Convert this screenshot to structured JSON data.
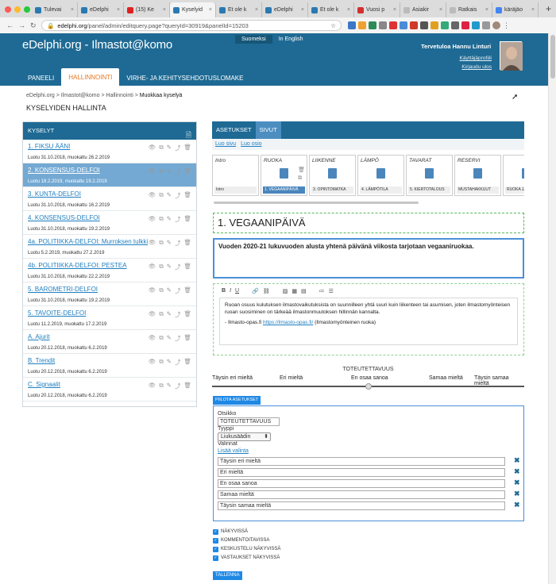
{
  "browser": {
    "tabs": [
      {
        "label": "Tulevai",
        "color": "#2a7ab0"
      },
      {
        "label": "eDelphi",
        "color": "#2a7ab0"
      },
      {
        "label": "(15) Ke",
        "color": "#e02020"
      },
      {
        "label": "Kyselyid",
        "color": "#2a7ab0",
        "active": true
      },
      {
        "label": "Et ole k",
        "color": "#2a7ab0"
      },
      {
        "label": "eDelphi",
        "color": "#2a7ab0"
      },
      {
        "label": "Et ole k",
        "color": "#2a7ab0"
      },
      {
        "label": "Vuosi p",
        "color": "#d32f2f"
      },
      {
        "label": "Asiakir",
        "color": "#bbb"
      },
      {
        "label": "Ratkais",
        "color": "#bbb"
      },
      {
        "label": "käräjäo",
        "color": "#4285f4"
      }
    ],
    "url_host": "edelphi.org",
    "url_path": "/panel/admin/editquery.page?queryId=30919&panelId=15203"
  },
  "header": {
    "logo": "eDelphi.org - Ilmastot@komo",
    "lang_fi": "Suomeksi",
    "lang_en": "In English",
    "welcome": "Tervetuloa  Hannu Linturi",
    "profile_link": "Käyttäjäprofiili",
    "logout_link": "Kirjaudu ulos",
    "nav": [
      "PANEELI",
      "HALLINNOINTI",
      "VIRHE- JA KEHITYSEHDOTUSLOMAKE"
    ]
  },
  "breadcrumb": {
    "items": [
      "eDelphi.org",
      "Ilmastot@komo",
      "Hallinnointi"
    ],
    "current": "Muokkaa kyselyä"
  },
  "page_title": "KYSELYIDEN HALLINTA",
  "left_panel": {
    "title": "KYSELYT",
    "queries": [
      {
        "title": "1. FIKSU ÄÄNI",
        "meta": "Luotu 31.10.2018, muokattu 26.2.2019"
      },
      {
        "title": "2. KONSENSUS-DELFOI",
        "meta": "Luotu 18.2.2019, muokattu 19.2.2019",
        "selected": true
      },
      {
        "title": "3. KUNTA-DELFOI",
        "meta": "Luotu 31.10.2018, muokattu 16.2.2019"
      },
      {
        "title": "4. KONSENSUS-DELFOI",
        "meta": "Luotu 31.10.2018, muokattu 19.2.2019"
      },
      {
        "title": "4a. POLITIIKKA-DELFOI: Murroksen tulkki",
        "meta": "Luotu 5.2.2019, muokattu 27.2.2019"
      },
      {
        "title": "4b. POLITIIKKA-DELFOI: PESTEA",
        "meta": "Luotu 31.10.2018, muokattu 22.2.2019"
      },
      {
        "title": "5. BAROMETRI-DELFOI",
        "meta": "Luotu 31.10.2018, muokattu 19.2.2019"
      },
      {
        "title": "5. TAVOITE-DELFOI",
        "meta": "Luotu 11.2.2019, muokattu 17.2.2019"
      },
      {
        "title": "A. Ajurit",
        "meta": "Luotu 20.12.2018, muokattu 6.2.2019"
      },
      {
        "title": "B. Trendit",
        "meta": "Luotu 20.12.2018, muokattu 6.2.2019"
      },
      {
        "title": "C. Signaalit",
        "meta": "Luotu 20.12.2018, muokattu 6.2.2019"
      }
    ]
  },
  "right_panel": {
    "tabs": [
      "ASETUKSET",
      "SIVUT"
    ],
    "links": [
      "Luo sivu",
      "Luo osio"
    ],
    "sections": [
      {
        "name": "Intro",
        "page": "Intro"
      },
      {
        "name": "RUOKA",
        "page": "1. VEGAANIPÄIVÄ",
        "selected": true
      },
      {
        "name": "LIIKENNE",
        "page": "3. OPINTOMATKA"
      },
      {
        "name": "LÄMPÖ",
        "page": "4. LÄMPÖTILA"
      },
      {
        "name": "TAVARAT",
        "page": "5. KIERTOTALOUS"
      },
      {
        "name": "RESERVI",
        "page": "MUSTAHAKKUUT"
      },
      {
        "name": "",
        "page": "RUOKA JA R"
      }
    ],
    "page_title": "1. VEGAANIPÄIVÄ",
    "question": "Vuoden 2020-21 lukuvuoden alusta yhtenä päivänä viikosta tarjotaan vegaaniruokaa.",
    "editor_p1": "Ruoan osuus kulutuksen ilmastovaikutuksista on suunnilleen yhtä suuri kuin liikenteen tai asumisen, joten ilmastomyönteisen ruoan suosiminen on tärkeää ilmastonmuutoksen hillinnän kannalta.",
    "editor_p2_pre": "- Ilmasto-opas.fi ",
    "editor_link": "https://ilmasto-opas.fi/",
    "editor_p2_post": " (Ilmastomyönteinen ruoka)",
    "slider_label": "TOTEUTETTAVUUS",
    "slider_ticks": [
      "Täysin eri mieltä",
      "Eri mieltä",
      "En osaa sanoa",
      "Samaa mieltä",
      "Täysin samaa mieltä"
    ],
    "hide_settings": "PIILOTA ASETUKSET",
    "settings": {
      "title_label": "Otsikko",
      "title_value": "TOTEUTETTAVUUS",
      "type_label": "Tyyppi",
      "type_value": "Liukusäädin",
      "options_label": "Valinnat",
      "add_option": "Lisää valinta",
      "options": [
        "Täysin eri mieltä",
        "Eri mieltä",
        "En osaa sanoa",
        "Samaa mieltä",
        "Täysin samaa mieltä"
      ]
    },
    "checkboxes": [
      "NÄKYVISSÄ",
      "KOMMENTOITAVISSA",
      "KESKUSTELU NÄKYVISSÄ",
      "VASTAUKSET NÄKYVISSÄ"
    ],
    "save": "TALLENNA"
  }
}
